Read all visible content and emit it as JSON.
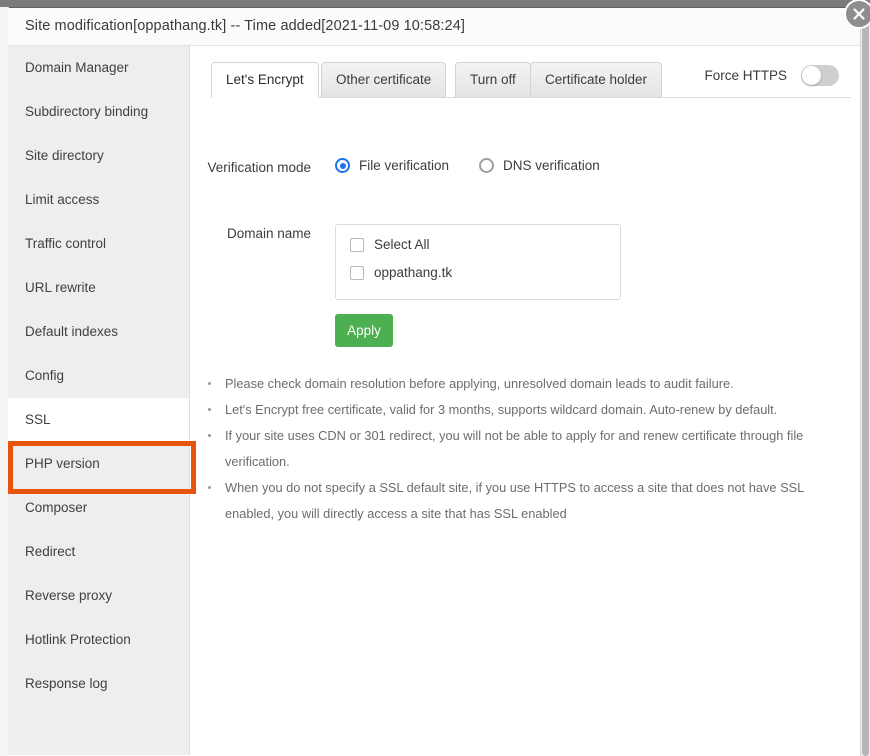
{
  "window": {
    "title": "Site modification[oppathang.tk] -- Time added[2021-11-09 10:58:24]",
    "close_icon": "close-icon"
  },
  "sidebar": {
    "items": [
      {
        "label": "Domain Manager",
        "active": false
      },
      {
        "label": "Subdirectory binding",
        "active": false
      },
      {
        "label": "Site directory",
        "active": false
      },
      {
        "label": "Limit access",
        "active": false
      },
      {
        "label": "Traffic control",
        "active": false
      },
      {
        "label": "URL rewrite",
        "active": false
      },
      {
        "label": "Default indexes",
        "active": false
      },
      {
        "label": "Config",
        "active": false
      },
      {
        "label": "SSL",
        "active": true
      },
      {
        "label": "PHP version",
        "active": false
      },
      {
        "label": "Composer",
        "active": false
      },
      {
        "label": "Redirect",
        "active": false
      },
      {
        "label": "Reverse proxy",
        "active": false
      },
      {
        "label": "Hotlink Protection",
        "active": false
      },
      {
        "label": "Response log",
        "active": false
      }
    ],
    "highlight_color": "#e8540c",
    "highlighted_item": "SSL"
  },
  "content": {
    "tabs": [
      {
        "label": "Let's Encrypt",
        "active": true
      },
      {
        "label": "Other certificate",
        "active": false
      },
      {
        "label": "Turn off",
        "active": false
      },
      {
        "label": "Certificate holder",
        "active": false
      }
    ],
    "force_https": {
      "label": "Force HTTPS",
      "enabled": false
    },
    "verification": {
      "label": "Verification mode",
      "options": [
        {
          "label": "File verification",
          "selected": true
        },
        {
          "label": "DNS verification",
          "selected": false
        }
      ]
    },
    "domain": {
      "label": "Domain name",
      "checkboxes": [
        {
          "label": "Select All",
          "checked": false
        },
        {
          "label": "oppathang.tk",
          "checked": false
        }
      ]
    },
    "apply_label": "Apply",
    "apply_color": "#4caf50",
    "notes": [
      "Please check domain resolution before applying, unresolved domain leads to audit failure.",
      "Let's Encrypt free certificate, valid for 3 months, supports wildcard domain. Auto-renew by default.",
      "If your site uses CDN or 301 redirect, you will not be able to apply for and renew certificate through file verification.",
      "When you do not specify a SSL default site, if you use HTTPS to access a site that does not have SSL enabled, you will directly access a site that has SSL enabled"
    ]
  }
}
